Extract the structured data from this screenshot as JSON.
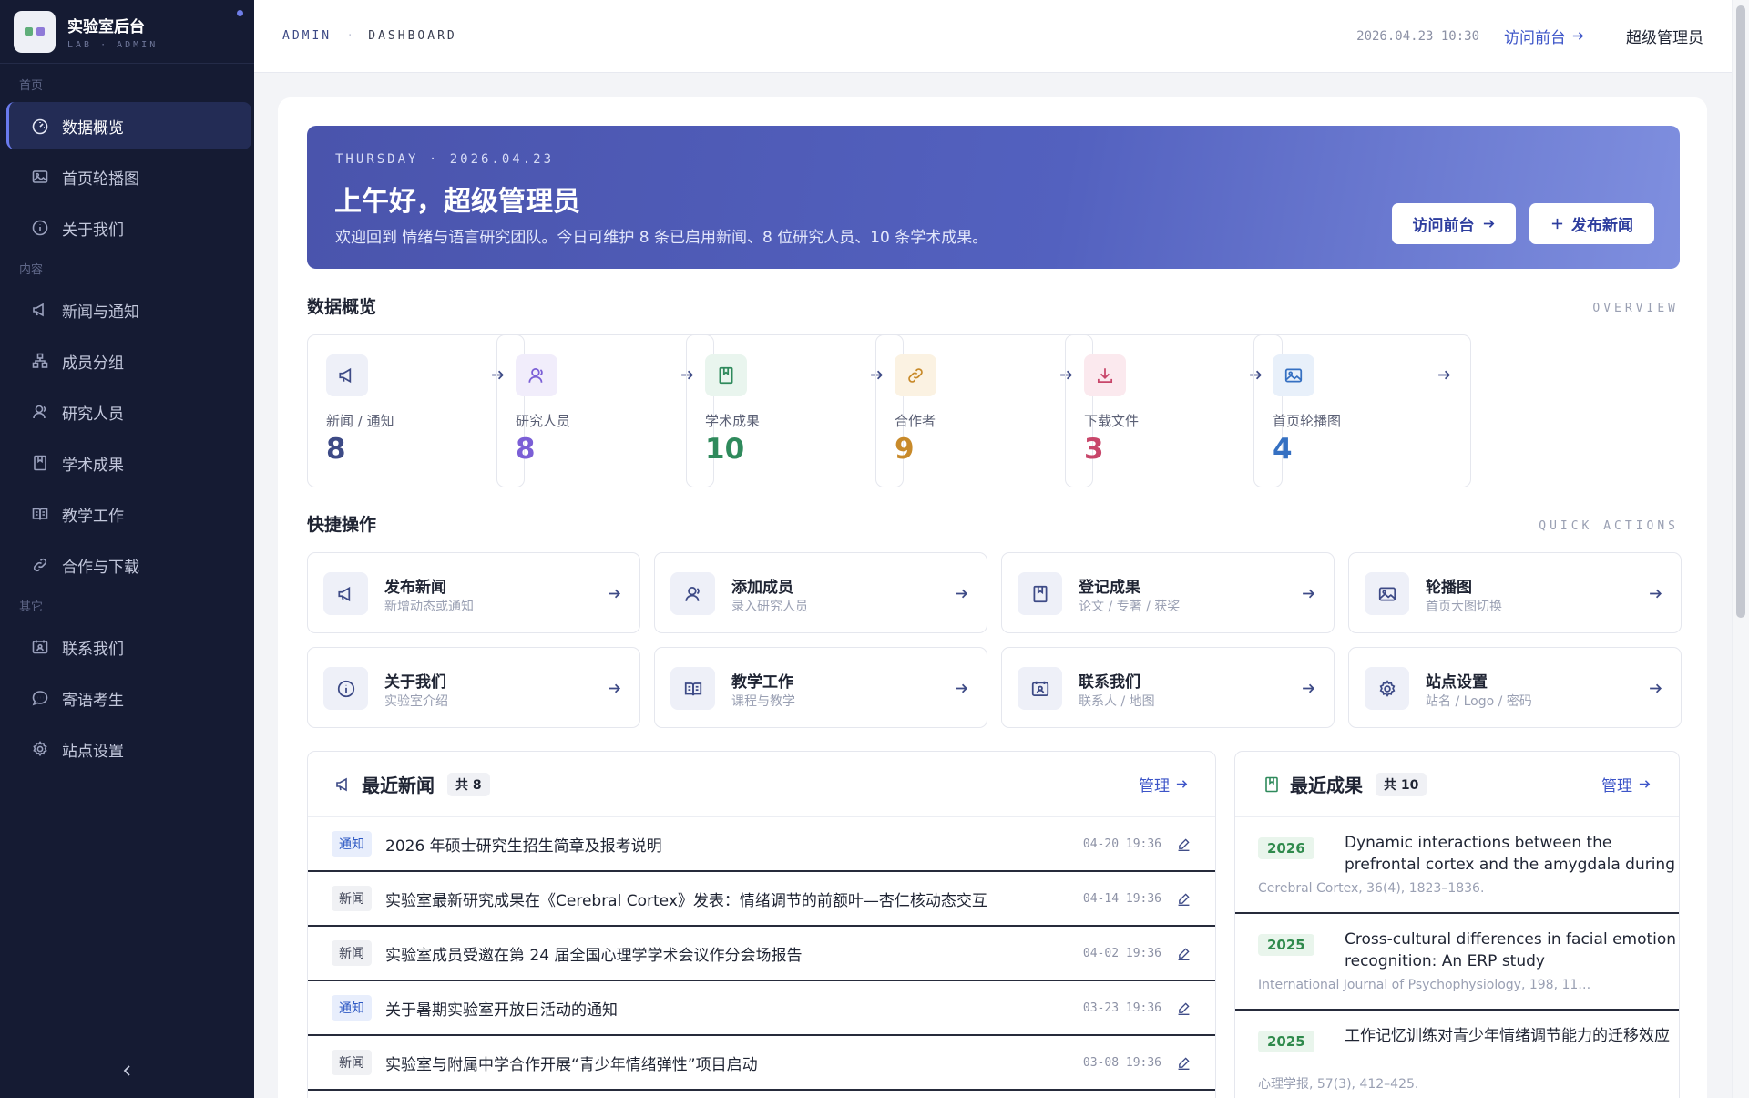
{
  "brand": {
    "title": "实验室后台",
    "subtitle": "LAB · ADMIN"
  },
  "sidebar": {
    "sections": [
      {
        "label": "首页",
        "items": [
          {
            "label": "数据概览",
            "icon": "dashboard-icon",
            "active": true
          },
          {
            "label": "首页轮播图",
            "icon": "image-icon"
          },
          {
            "label": "关于我们",
            "icon": "info-icon"
          }
        ]
      },
      {
        "label": "内容",
        "items": [
          {
            "label": "新闻与通知",
            "icon": "megaphone-icon"
          },
          {
            "label": "成员分组",
            "icon": "group-icon"
          },
          {
            "label": "研究人员",
            "icon": "user-icon"
          },
          {
            "label": "学术成果",
            "icon": "book-icon"
          },
          {
            "label": "教学工作",
            "icon": "open-book-icon"
          },
          {
            "label": "合作与下载",
            "icon": "link-icon"
          }
        ]
      },
      {
        "label": "其它",
        "items": [
          {
            "label": "联系我们",
            "icon": "contact-icon"
          },
          {
            "label": "寄语考生",
            "icon": "chat-icon"
          },
          {
            "label": "站点设置",
            "icon": "gear-icon"
          }
        ]
      }
    ]
  },
  "topbar": {
    "crumb1": "ADMIN",
    "crumb_sep": "·",
    "crumb2": "DASHBOARD",
    "datetime": "2026.04.23 10:30",
    "visit_label": "访问前台",
    "user": "超级管理员"
  },
  "hero": {
    "date": "THURSDAY · 2026.04.23",
    "greeting": "上午好，超级管理员",
    "summary": "欢迎回到 情绪与语言研究团队。今日可维护 8 条已启用新闻、8 位研究人员、10 条学术成果。",
    "visit_button": "访问前台",
    "publish_button": "发布新闻"
  },
  "overview": {
    "title": "数据概览",
    "tag": "OVERVIEW",
    "stats": [
      {
        "label": "新闻 / 通知",
        "value": "8",
        "icon": "megaphone-icon",
        "color": "#3d4a86",
        "bg": "#eef0f8"
      },
      {
        "label": "研究人员",
        "value": "8",
        "icon": "user-icon",
        "color": "#7b5fd6",
        "bg": "#f1edfb"
      },
      {
        "label": "学术成果",
        "value": "10",
        "icon": "book-icon",
        "color": "#2f8a5c",
        "bg": "#e9f5ee"
      },
      {
        "label": "合作者",
        "value": "9",
        "icon": "link-icon",
        "color": "#c88a2a",
        "bg": "#fbf2e2"
      },
      {
        "label": "下载文件",
        "value": "3",
        "icon": "download-icon",
        "color": "#c8466a",
        "bg": "#fbe9ee"
      },
      {
        "label": "首页轮播图",
        "value": "4",
        "icon": "image-icon",
        "color": "#3570c2",
        "bg": "#e8f0fa"
      }
    ]
  },
  "quick": {
    "title": "快捷操作",
    "tag": "QUICK ACTIONS",
    "actions": [
      {
        "title": "发布新闻",
        "sub": "新增动态或通知",
        "icon": "megaphone-icon"
      },
      {
        "title": "添加成员",
        "sub": "录入研究人员",
        "icon": "user-icon"
      },
      {
        "title": "登记成果",
        "sub": "论文 / 专著 / 获奖",
        "icon": "book-icon"
      },
      {
        "title": "轮播图",
        "sub": "首页大图切换",
        "icon": "image-icon"
      },
      {
        "title": "关于我们",
        "sub": "实验室介绍",
        "icon": "info-icon"
      },
      {
        "title": "教学工作",
        "sub": "课程与教学",
        "icon": "open-book-icon"
      },
      {
        "title": "联系我们",
        "sub": "联系人 / 地图",
        "icon": "contact-icon"
      },
      {
        "title": "站点设置",
        "sub": "站名 / Logo / 密码",
        "icon": "gear-icon"
      }
    ]
  },
  "news": {
    "title": "最近新闻",
    "count": "共 8",
    "manage": "管理",
    "rows": [
      {
        "tag": "通知",
        "type": "notice",
        "title": "2026 年硕士研究生招生简章及报考说明",
        "time": "04-20 19:36"
      },
      {
        "tag": "新闻",
        "type": "news",
        "title": "实验室最新研究成果在《Cerebral Cortex》发表：情绪调节的前额叶—杏仁核动态交互",
        "time": "04-14 19:36"
      },
      {
        "tag": "新闻",
        "type": "news",
        "title": "实验室成员受邀在第 24 届全国心理学学术会议作分会场报告",
        "time": "04-02 19:36"
      },
      {
        "tag": "通知",
        "type": "notice",
        "title": "关于暑期实验室开放日活动的通知",
        "time": "03-23 19:36"
      },
      {
        "tag": "新闻",
        "type": "news",
        "title": "实验室与附属中学合作开展“青少年情绪弹性”项目启动",
        "time": "03-08 19:36"
      }
    ]
  },
  "pubs": {
    "title": "最近成果",
    "count": "共 10",
    "manage": "管理",
    "rows": [
      {
        "year": "2026",
        "title": "Dynamic interactions between the prefrontal cortex and the amygdala during cognitive…",
        "meta": "Cerebral Cortex, 36(4), 1823–1836."
      },
      {
        "year": "2025",
        "title": "Cross-cultural differences in facial emotion recognition: An ERP study",
        "meta": "International Journal of Psychophysiology, 198, 11…"
      },
      {
        "year": "2025",
        "title": "工作记忆训练对青少年情绪调节能力的迁移效应",
        "meta": "心理学报, 57(3), 412–425."
      }
    ]
  }
}
